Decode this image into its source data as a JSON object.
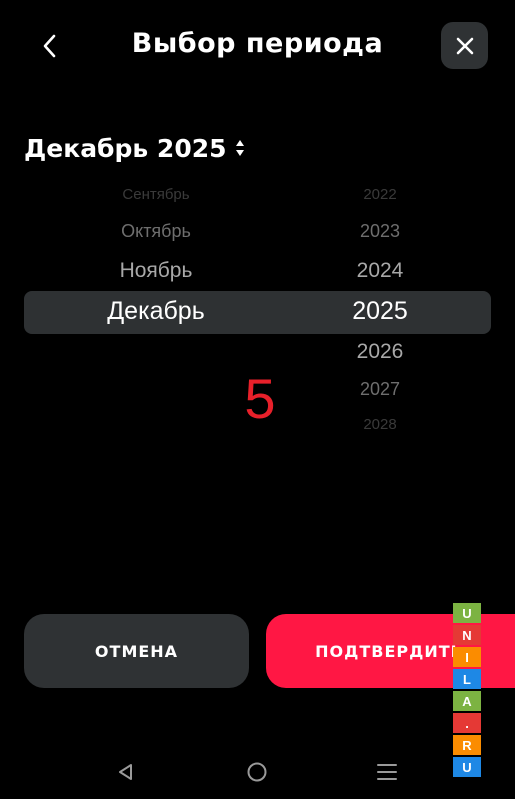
{
  "header": {
    "title": "Выбор периода",
    "back_icon": "chevron-left-icon",
    "close_icon": "close-icon"
  },
  "period": {
    "label": "Декабрь 2025",
    "icon": "sort-updown-icon"
  },
  "picker": {
    "months": [
      "Сентябрь",
      "Октябрь",
      "Ноябрь",
      "Декабрь",
      "",
      "",
      ""
    ],
    "years": [
      "2022",
      "2023",
      "2024",
      "2025",
      "2026",
      "2027",
      "2028"
    ],
    "selected_month": "Декабрь",
    "selected_year": "2025"
  },
  "overlay_number": "5",
  "buttons": {
    "cancel": "ОТМЕНА",
    "confirm": "ПОДТВЕРДИТЬ"
  },
  "watermark": {
    "letters": [
      "U",
      "N",
      "I",
      "L",
      "A",
      ".",
      "R",
      "U"
    ],
    "colors": [
      "#7cb342",
      "#e53935",
      "#fb8c00",
      "#1e88e5",
      "#7cb342",
      "#e53935",
      "#fb8c00",
      "#1e88e5"
    ]
  },
  "navbar": {
    "back_icon": "nav-back-icon",
    "home_icon": "nav-home-icon",
    "recents_icon": "nav-recents-icon"
  },
  "colors": {
    "background": "#000000",
    "surface": "#2f3234",
    "accent": "#ff1744",
    "overlay_number": "#e8202a"
  }
}
